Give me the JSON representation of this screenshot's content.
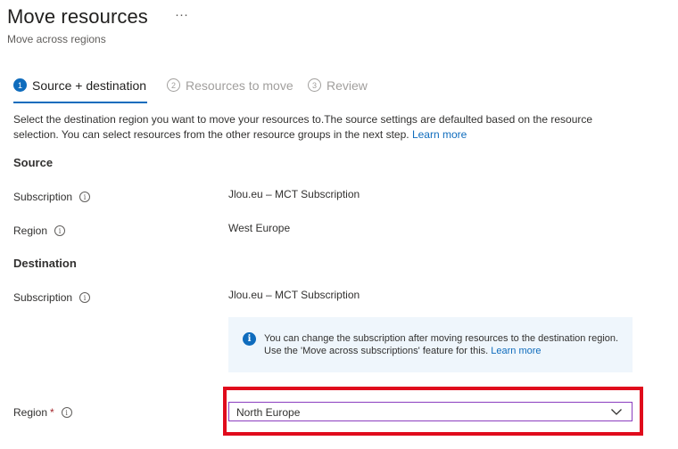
{
  "header": {
    "title": "Move resources",
    "more_label": "···",
    "subtitle": "Move across regions"
  },
  "tabs": [
    {
      "num": "1",
      "label": "Source + destination",
      "active": true
    },
    {
      "num": "2",
      "label": "Resources to move",
      "active": false
    },
    {
      "num": "3",
      "label": "Review",
      "active": false
    }
  ],
  "description": {
    "text": "Select the destination region you want to move your resources to.The source settings are defaulted based on the resource selection. You can select resources from the other resource groups in the next step.",
    "link": "Learn more"
  },
  "source": {
    "heading": "Source",
    "subscription_label": "Subscription",
    "subscription_value": "Jlou.eu – MCT Subscription",
    "region_label": "Region",
    "region_value": "West Europe"
  },
  "destination": {
    "heading": "Destination",
    "subscription_label": "Subscription",
    "subscription_value": "Jlou.eu – MCT Subscription",
    "info_text": "You can change the subscription after moving resources to the destination region. Use the 'Move across subscriptions' feature for this.",
    "info_link": "Learn more",
    "region_label": "Region",
    "required_mark": "*",
    "region_value": "North Europe"
  },
  "icons": {
    "info": "info-icon",
    "chevron": "chevron-down-icon"
  },
  "colors": {
    "accent": "#0f6cbd",
    "highlight": "#e00b1c",
    "dropdown_border": "#8a3dbf",
    "info_bg": "#eff6fc"
  }
}
